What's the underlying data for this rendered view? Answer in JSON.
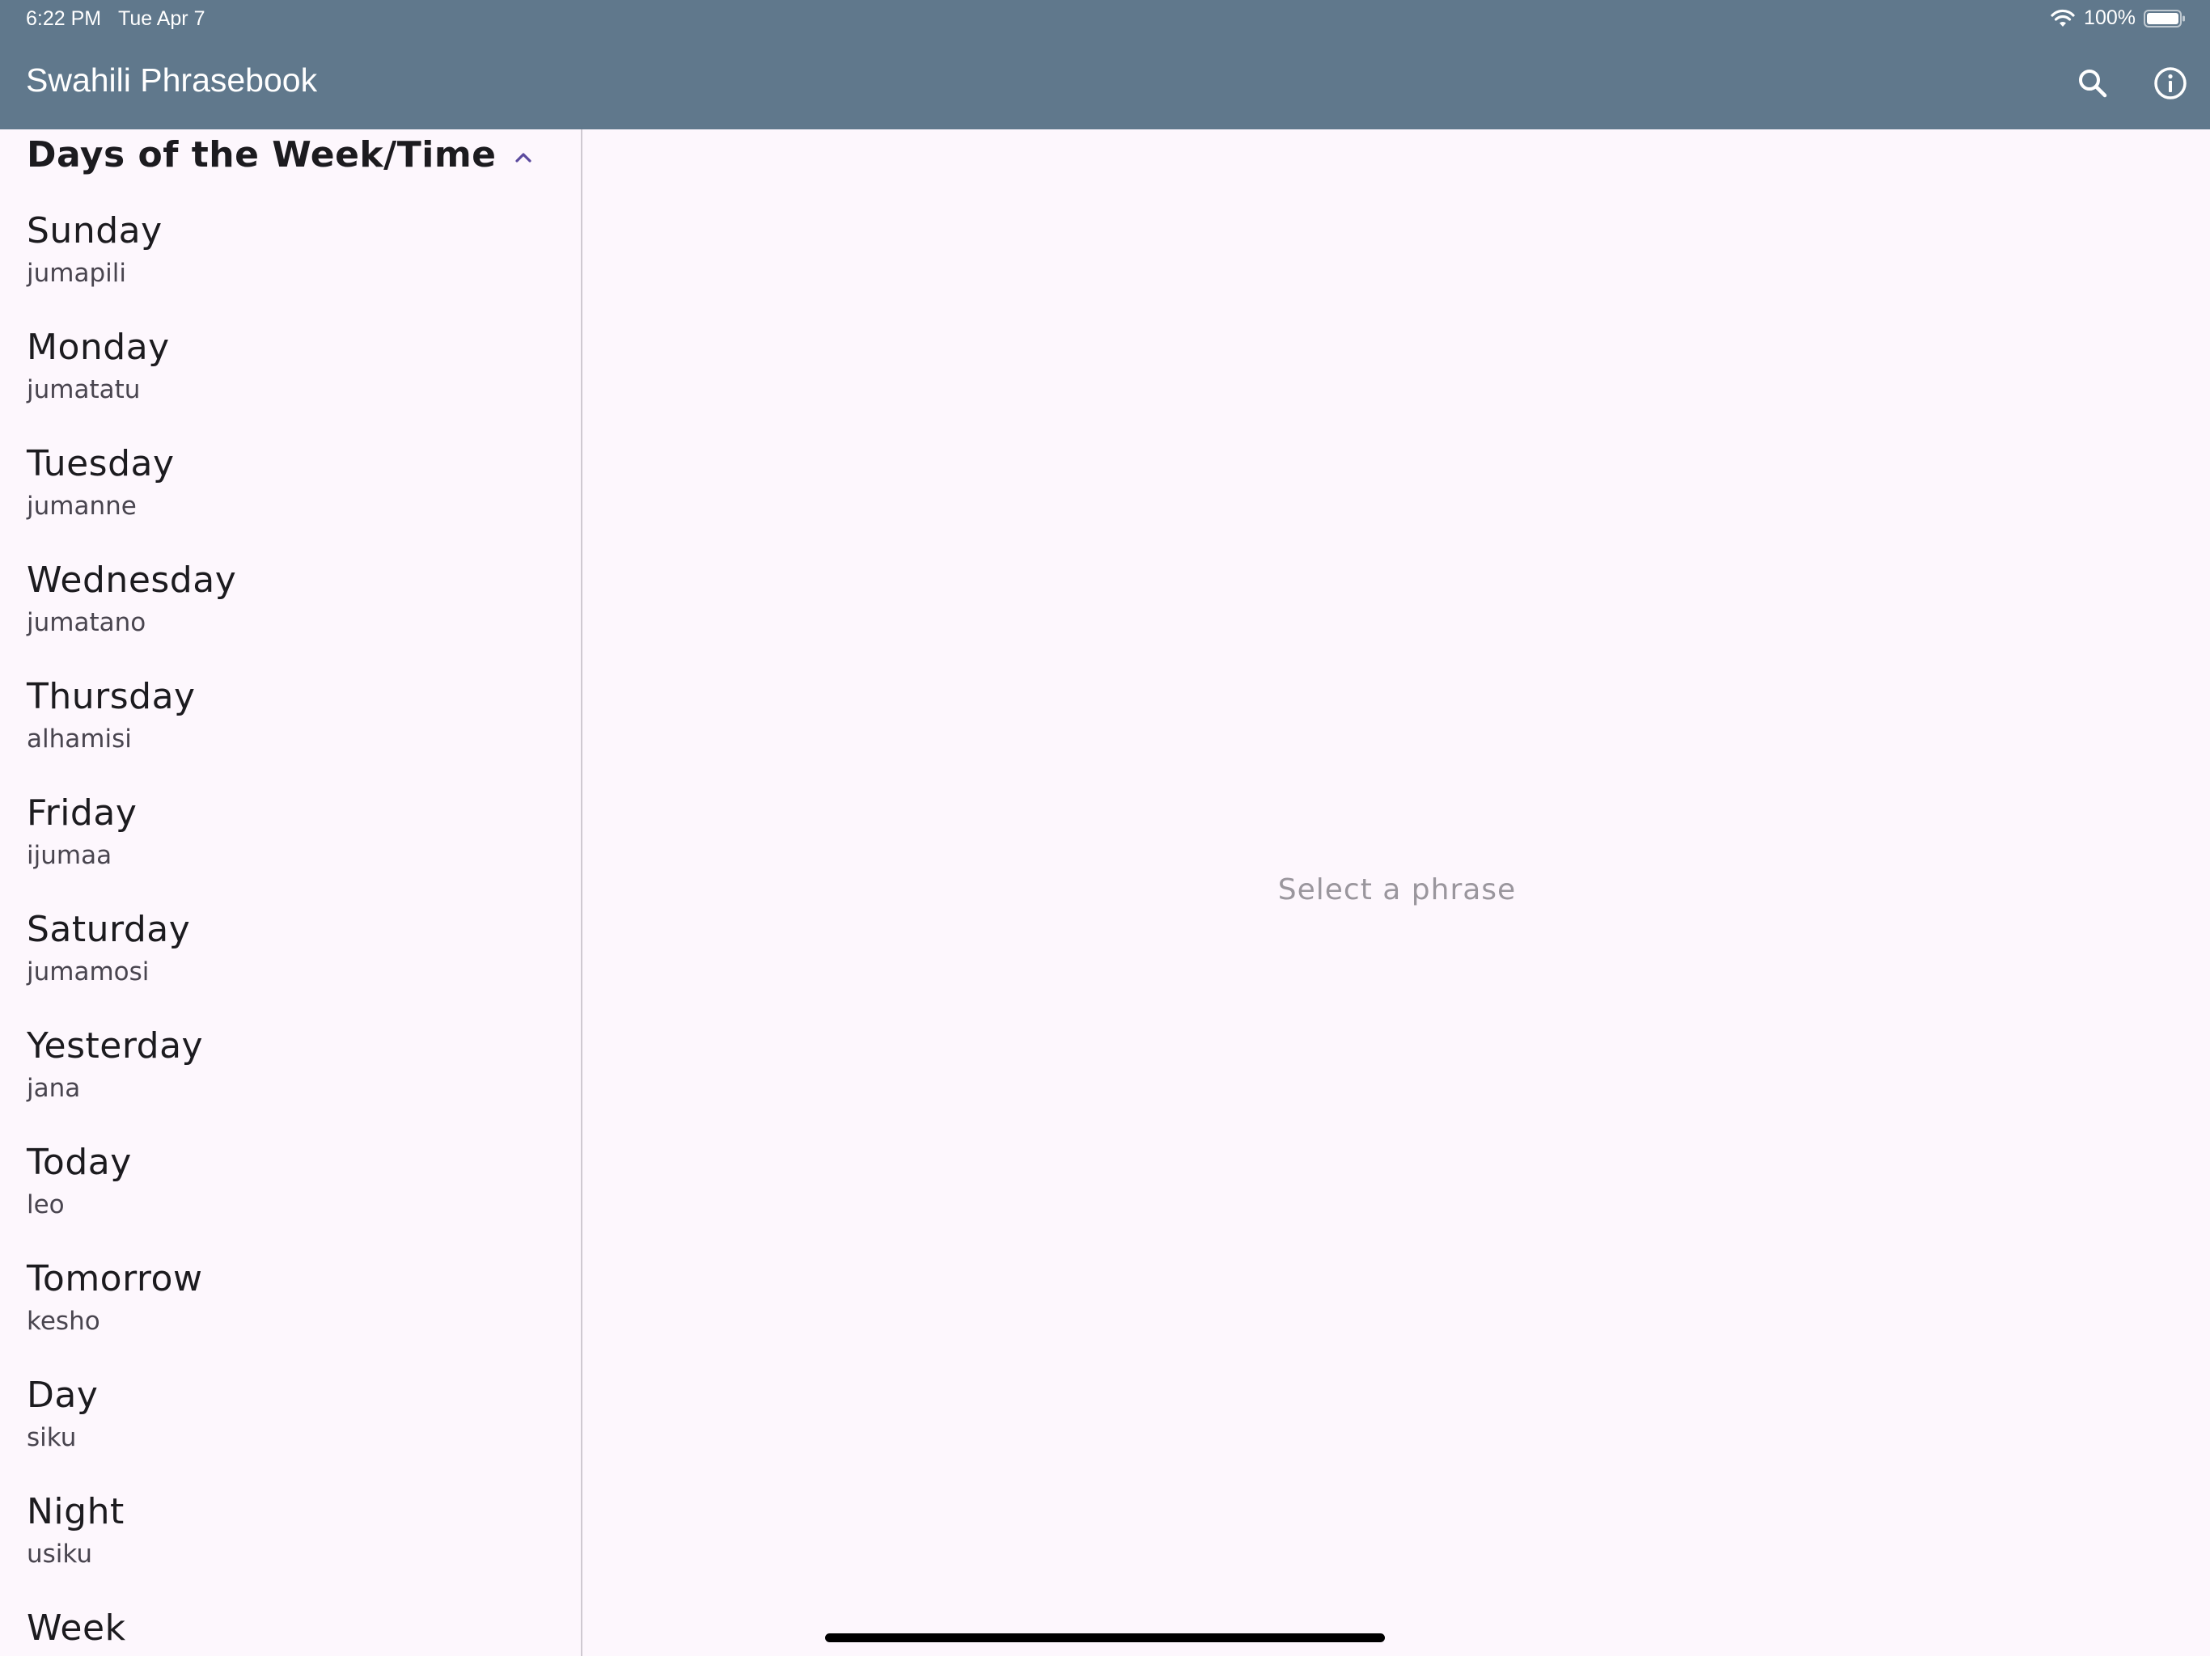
{
  "status_bar": {
    "time": "6:22 PM",
    "date": "Tue Apr 7",
    "battery": "100%"
  },
  "app_bar": {
    "title": "Swahili Phrasebook",
    "icons": [
      "search-icon",
      "info-icon"
    ]
  },
  "sidebar": {
    "section_title": "Days of the Week/Time",
    "section_expanded": true,
    "items": [
      {
        "english": "Sunday",
        "swahili": "jumapili"
      },
      {
        "english": "Monday",
        "swahili": "jumatatu"
      },
      {
        "english": "Tuesday",
        "swahili": "jumanne"
      },
      {
        "english": "Wednesday",
        "swahili": "jumatano"
      },
      {
        "english": "Thursday",
        "swahili": "alhamisi"
      },
      {
        "english": "Friday",
        "swahili": "ijumaa"
      },
      {
        "english": "Saturday",
        "swahili": "jumamosi"
      },
      {
        "english": "Yesterday",
        "swahili": "jana"
      },
      {
        "english": "Today",
        "swahili": "leo"
      },
      {
        "english": "Tomorrow",
        "swahili": "kesho"
      },
      {
        "english": "Day",
        "swahili": "siku"
      },
      {
        "english": "Night",
        "swahili": "usiku"
      },
      {
        "english": "Week",
        "swahili": ""
      }
    ]
  },
  "detail": {
    "placeholder": "Select a phrase"
  },
  "colors": {
    "app_bar": "#60788c",
    "background": "#fdf7fd",
    "accent": "#5b4a9e",
    "primary_text": "#1c1b1f",
    "secondary_text": "#49454f",
    "placeholder_text": "#9a969d"
  }
}
